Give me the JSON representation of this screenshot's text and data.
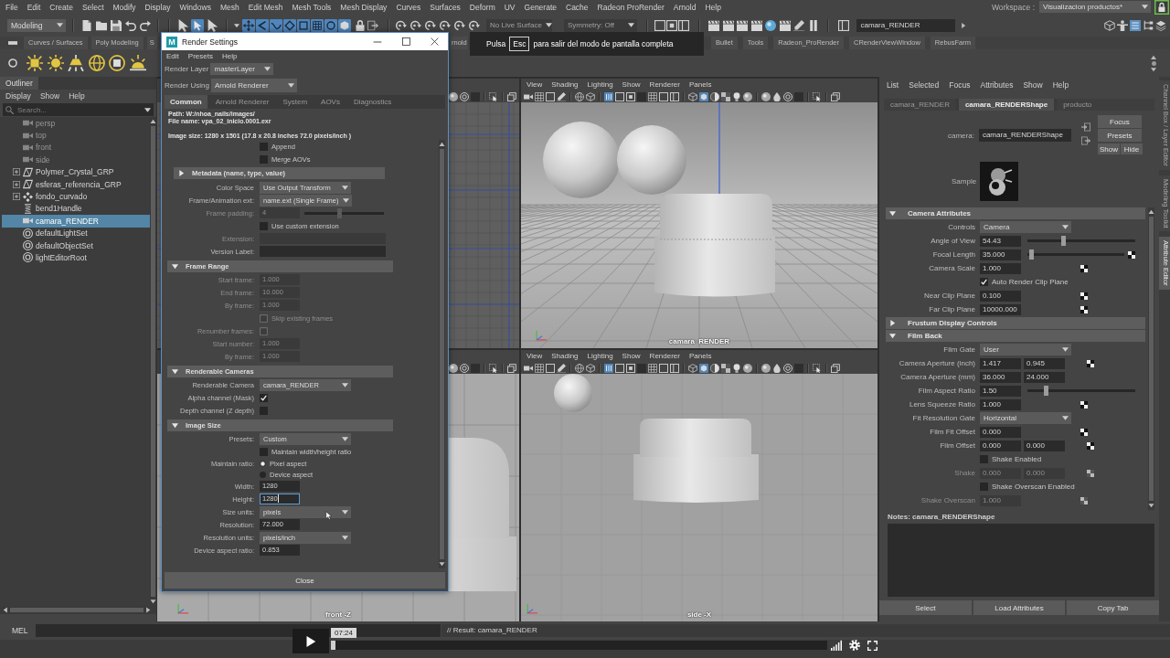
{
  "menu_bar": {
    "items": [
      "File",
      "Edit",
      "Create",
      "Select",
      "Modify",
      "Display",
      "Windows",
      "Mesh",
      "Edit Mesh",
      "Mesh Tools",
      "Mesh Display",
      "Curves",
      "Surfaces",
      "Deform",
      "UV",
      "Generate",
      "Cache",
      "Radeon ProRender",
      "Arnold",
      "Help"
    ],
    "workspace_label": "Workspace :",
    "workspace": "Visualizacion productos*"
  },
  "status_line": {
    "menu_set": "Modeling",
    "live_surface": "No Live Surface",
    "symmetry": "Symmetry: Off",
    "camera": "camara_RENDER"
  },
  "shelf": {
    "tabs": [
      {
        "label": "Curves / Surfaces",
        "selected": false
      },
      {
        "label": "Poly Modeling",
        "selected": false
      },
      {
        "label": "S",
        "selected": false
      },
      {
        "label": "rnold",
        "selected": false
      },
      {
        "label": "Bullet",
        "selected": false
      },
      {
        "label": "Tools",
        "selected": false
      },
      {
        "label": "Radeon_ProRender",
        "selected": false
      },
      {
        "label": "CRenderViewWindow",
        "selected": false
      },
      {
        "label": "RebusFarm",
        "selected": false
      }
    ]
  },
  "fullscreen_notice": {
    "before": "Pulsa",
    "key": "Esc",
    "after": "para salir del modo de pantalla completa"
  },
  "outliner": {
    "title": "Outliner",
    "menu": [
      "Display",
      "Show",
      "Help"
    ],
    "search": {
      "placeholder": "Search..."
    },
    "items": [
      {
        "label": "persp",
        "kind": "camera",
        "dimmed": true,
        "expandable": false,
        "selected": false
      },
      {
        "label": "top",
        "kind": "camera",
        "dimmed": true,
        "expandable": false,
        "selected": false
      },
      {
        "label": "front",
        "kind": "camera",
        "dimmed": true,
        "expandable": false,
        "selected": false
      },
      {
        "label": "side",
        "kind": "camera",
        "dimmed": true,
        "expandable": false,
        "selected": false
      },
      {
        "label": "Polymer_Crystal_GRP",
        "kind": "transform",
        "dimmed": false,
        "expandable": true,
        "expanded": false,
        "selected": false
      },
      {
        "label": "esferas_referencia_GRP",
        "kind": "transform",
        "dimmed": false,
        "expandable": true,
        "expanded": false,
        "selected": false
      },
      {
        "label": "fondo_curvado",
        "kind": "node",
        "dimmed": false,
        "expandable": true,
        "expanded": false,
        "selected": false
      },
      {
        "label": "bend1Handle",
        "kind": "handle",
        "dimmed": false,
        "expandable": false,
        "selected": false
      },
      {
        "label": "camara_RENDER",
        "kind": "camera",
        "dimmed": false,
        "expandable": false,
        "selected": true
      },
      {
        "label": "defaultLightSet",
        "kind": "set",
        "dimmed": false,
        "expandable": false,
        "selected": false
      },
      {
        "label": "defaultObjectSet",
        "kind": "set",
        "dimmed": false,
        "expandable": false,
        "selected": false
      },
      {
        "label": "lightEditorRoot",
        "kind": "set",
        "dimmed": false,
        "expandable": false,
        "selected": false
      }
    ]
  },
  "viewports": [
    {
      "kind": "grid"
    },
    {
      "kind": "perspective",
      "menu": [
        "View",
        "Shading",
        "Lighting",
        "Show",
        "Renderer",
        "Panels"
      ],
      "label": "camara_RENDER"
    },
    {
      "kind": "front",
      "label": "front -Z"
    },
    {
      "kind": "side",
      "menu": [
        "View",
        "Shading",
        "Lighting",
        "Show",
        "Renderer",
        "Panels"
      ],
      "label": "side -X"
    }
  ],
  "render_settings": {
    "logo": "M",
    "title": "Render Settings",
    "menu": [
      "Edit",
      "Presets",
      "Help"
    ],
    "render_layer": {
      "label": "Render Layer",
      "value": "masterLayer"
    },
    "render_using": {
      "label": "Render Using",
      "value": "Arnold Renderer"
    },
    "tabs": [
      {
        "label": "Common",
        "selected": true
      },
      {
        "label": "Arnold Renderer",
        "selected": false
      },
      {
        "label": "System",
        "selected": false
      },
      {
        "label": "AOVs",
        "selected": false
      },
      {
        "label": "Diagnostics",
        "selected": false
      }
    ],
    "path": "Path: W:/nhoa_nails/images/",
    "file_name": "File name: vpa_02_inicio.0001.exr",
    "image_size": "Image size: 1280 x 1501 (17.8 x 20.8 inches 72.0 pixels/inch )",
    "rows": [
      {
        "kind": "checkbox",
        "text": "Append",
        "checked": false,
        "disabled": false
      },
      {
        "kind": "checkbox",
        "text": "Merge AOVs",
        "checked": false,
        "disabled": false
      },
      {
        "kind": "subheader",
        "text": "Metadata (name, type, value)",
        "expanded": false
      },
      {
        "kind": "dropdown",
        "label": "Color Space",
        "value": "Use Output Transform",
        "disabled": false
      },
      {
        "kind": "dropdown",
        "label": "Frame/Animation ext:",
        "value": "name.ext (Single Frame)",
        "disabled": false
      },
      {
        "kind": "slider",
        "label": "Frame padding:",
        "value": "4",
        "level": 0.44,
        "disabled": true
      },
      {
        "kind": "checkbox",
        "text": "Use custom extension",
        "checked": false,
        "disabled": false
      },
      {
        "kind": "text",
        "label": "Extension:",
        "disabled": true
      },
      {
        "kind": "text",
        "label": "Version Label:",
        "disabled": false
      },
      {
        "kind": "header",
        "text": "Frame Range",
        "expanded": true
      },
      {
        "kind": "number",
        "label": "Start frame:",
        "value": "1.000",
        "disabled": true,
        "focused": false
      },
      {
        "kind": "number",
        "label": "End frame:",
        "value": "10.000",
        "disabled": true,
        "focused": false
      },
      {
        "kind": "number",
        "label": "By frame:",
        "value": "1.000",
        "disabled": true,
        "focused": false
      },
      {
        "kind": "checkbox",
        "text": "Skip existing frames",
        "checked": false,
        "disabled": true
      },
      {
        "kind": "labeled_checkbox",
        "label": "Renumber frames:",
        "checked": false,
        "disabled": true
      },
      {
        "kind": "number",
        "label": "Start number:",
        "value": "1.000",
        "disabled": true,
        "focused": false
      },
      {
        "kind": "number",
        "label": "By frame:",
        "value": "1.000",
        "disabled": true,
        "focused": false
      },
      {
        "kind": "header",
        "text": "Renderable Cameras",
        "expanded": true
      },
      {
        "kind": "dropdown",
        "label": "Renderable Camera",
        "value": "camara_RENDER",
        "disabled": false
      },
      {
        "kind": "labeled_checkbox",
        "label": "Alpha channel (Mask)",
        "checked": true,
        "disabled": false
      },
      {
        "kind": "labeled_checkbox",
        "label": "Depth channel (Z depth)",
        "checked": false,
        "disabled": false
      },
      {
        "kind": "header",
        "text": "Image Size",
        "expanded": true
      },
      {
        "kind": "dropdown",
        "label": "Presets:",
        "value": "Custom",
        "disabled": false
      },
      {
        "kind": "checkbox",
        "text": "Maintain width/height ratio",
        "checked": false,
        "disabled": false
      },
      {
        "kind": "radio",
        "label": "Maintain ratio:",
        "options": [
          {
            "text": "Pixel aspect",
            "selected": true
          },
          {
            "text": "Device aspect",
            "selected": false
          }
        ],
        "disabled": false
      },
      {
        "kind": "number",
        "label": "Width:",
        "value": "1280",
        "disabled": false,
        "focused": false
      },
      {
        "kind": "number",
        "label": "Height:",
        "value": "1280",
        "disabled": false,
        "focused": true
      },
      {
        "kind": "dropdown",
        "label": "Size units:",
        "value": "pixels",
        "disabled": false
      },
      {
        "kind": "number",
        "label": "Resolution:",
        "value": "72.000",
        "disabled": false,
        "focused": false
      },
      {
        "kind": "dropdown",
        "label": "Resolution units:",
        "value": "pixels/inch",
        "disabled": false
      },
      {
        "kind": "number",
        "label": "Device aspect ratio:",
        "value": "0.853",
        "disabled": false,
        "focused": false
      }
    ],
    "close": "Close"
  },
  "attribute_editor": {
    "menu": [
      "List",
      "Selected",
      "Focus",
      "Attributes",
      "Show",
      "Help"
    ],
    "tabs": [
      {
        "label": "camara_RENDER",
        "selected": false
      },
      {
        "label": "camara_RENDERShape",
        "selected": true
      },
      {
        "label": "producto",
        "selected": false
      }
    ],
    "node": {
      "label": "camera:",
      "value": "camara_RENDERShape"
    },
    "buttons": [
      "Focus",
      "Presets",
      "Show",
      "Hide"
    ],
    "sample_label": "Sample",
    "rows": [
      {
        "kind": "header",
        "text": "Camera Attributes",
        "expanded": true
      },
      {
        "kind": "dropdown",
        "label": "Controls",
        "value": "Camera",
        "disabled": false,
        "map_button": false
      },
      {
        "kind": "slider",
        "label": "Angle of View",
        "value": "54.43",
        "level": 0.33,
        "disabled": false,
        "map_button": false
      },
      {
        "kind": "slider",
        "label": "Focal Length",
        "value": "35.000",
        "level": 0.02,
        "disabled": false,
        "map_button": true
      },
      {
        "kind": "field",
        "label": "Camera Scale",
        "value": "1.000",
        "disabled": false,
        "map_button": true
      },
      {
        "kind": "checkbox",
        "text": "Auto Render Clip Plane",
        "checked": true,
        "disabled": false,
        "map_button": false
      },
      {
        "kind": "field",
        "label": "Near Clip Plane",
        "value": "0.100",
        "disabled": false,
        "map_button": true
      },
      {
        "kind": "field",
        "label": "Far Clip Plane",
        "value": "10000.000",
        "disabled": false,
        "map_button": true
      },
      {
        "kind": "header",
        "text": "Frustum Display Controls",
        "expanded": false
      },
      {
        "kind": "header",
        "text": "Film Back",
        "expanded": true
      },
      {
        "kind": "dropdown",
        "label": "Film Gate",
        "value": "User",
        "disabled": false,
        "map_button": false
      },
      {
        "kind": "pair",
        "label": "Camera Aperture (inch)",
        "values": [
          "1.417",
          "0.945"
        ],
        "disabled": false,
        "map_button": true
      },
      {
        "kind": "pair",
        "label": "Camera Aperture (mm)",
        "values": [
          "36.000",
          "24.000"
        ],
        "disabled": false,
        "map_button": false
      },
      {
        "kind": "slider",
        "label": "Film Aspect Ratio",
        "value": "1.50",
        "level": 0.16,
        "disabled": false,
        "map_button": false
      },
      {
        "kind": "field",
        "label": "Lens Squeeze Ratio",
        "value": "1.000",
        "disabled": false,
        "map_button": true
      },
      {
        "kind": "dropdown",
        "label": "Fit Resolution Gate",
        "value": "Horizontal",
        "disabled": false,
        "map_button": false
      },
      {
        "kind": "field",
        "label": "Film Fit Offset",
        "value": "0.000",
        "disabled": false,
        "map_button": true
      },
      {
        "kind": "pair",
        "label": "Film Offset",
        "values": [
          "0.000",
          "0.000"
        ],
        "disabled": false,
        "map_button": true
      },
      {
        "kind": "checkbox",
        "text": "Shake Enabled",
        "checked": false,
        "disabled": false,
        "map_button": false
      },
      {
        "kind": "pair",
        "label": "Shake",
        "values": [
          "0.000",
          "0.000"
        ],
        "disabled": true,
        "map_button": true
      },
      {
        "kind": "checkbox",
        "text": "Shake Overscan Enabled",
        "checked": false,
        "disabled": false,
        "map_button": false
      },
      {
        "kind": "field",
        "label": "Shake Overscan",
        "value": "1.000",
        "disabled": true,
        "map_button": true
      }
    ],
    "notes": "Notes: camara_RENDERShape",
    "bottom_buttons": [
      "Select",
      "Load Attributes",
      "Copy Tab"
    ]
  },
  "side_tabs": [
    {
      "label": "Channel Box / Layer Editor",
      "selected": false
    },
    {
      "label": "Modeling Toolkit",
      "selected": false
    },
    {
      "label": "Attribute Editor",
      "selected": true
    }
  ],
  "command_line": {
    "label": "MEL",
    "result": "// Result: camara_RENDER"
  },
  "video_player": {
    "time": "07:24",
    "level": 0.01
  }
}
